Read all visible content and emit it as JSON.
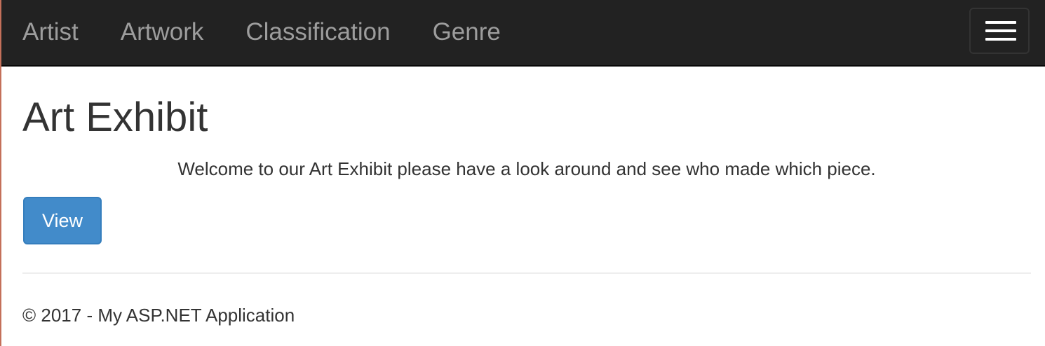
{
  "navbar": {
    "links": [
      {
        "label": "Artist"
      },
      {
        "label": "Artwork"
      },
      {
        "label": "Classification"
      },
      {
        "label": "Genre"
      }
    ],
    "toggle_icon": "hamburger-menu-icon",
    "background_color": "#222222",
    "link_color": "#9d9d9d"
  },
  "main": {
    "title": "Art Exhibit",
    "welcome_text": "Welcome to our Art Exhibit please have a look around and see who made which piece.",
    "view_button_label": "View",
    "button_color": "#428bca"
  },
  "footer": {
    "copyright": "© 2017 - My ASP.NET Application"
  }
}
